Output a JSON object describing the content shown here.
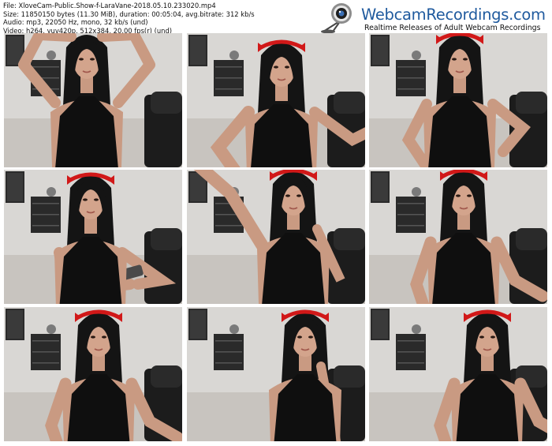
{
  "file_info": {
    "file": "File: XloveCam-Public.Show-f-LaraVane-2018.05.10.233020.mp4",
    "size": "Size: 11850150 bytes (11.30 MiB), duration: 00:05:04, avg.bitrate: 312 kb/s",
    "audio": "Audio: mp3, 22050 Hz, mono, 32 kb/s (und)",
    "video": "Video: h264, yuv420p, 512x384, 20.00 fps(r) (und)"
  },
  "brand": {
    "title": "WebcamRecordings.com",
    "tagline": "Realtime Releases of Adult Webcam Recordings",
    "icon": "webcam-icon",
    "title_color": "#1f5a9e"
  },
  "thumbnails": [
    {
      "pose": "arms-raised",
      "hair_band": false
    },
    {
      "pose": "leaning-forward",
      "hair_band": true
    },
    {
      "pose": "hand-on-hip",
      "hair_band": true
    },
    {
      "pose": "holding-phone",
      "hair_band": true
    },
    {
      "pose": "arm-raised",
      "hair_band": true
    },
    {
      "pose": "looking-up",
      "hair_band": true
    },
    {
      "pose": "looking-side",
      "hair_band": true
    },
    {
      "pose": "chin-on-hand",
      "hair_band": true
    },
    {
      "pose": "profile",
      "hair_band": true
    }
  ]
}
